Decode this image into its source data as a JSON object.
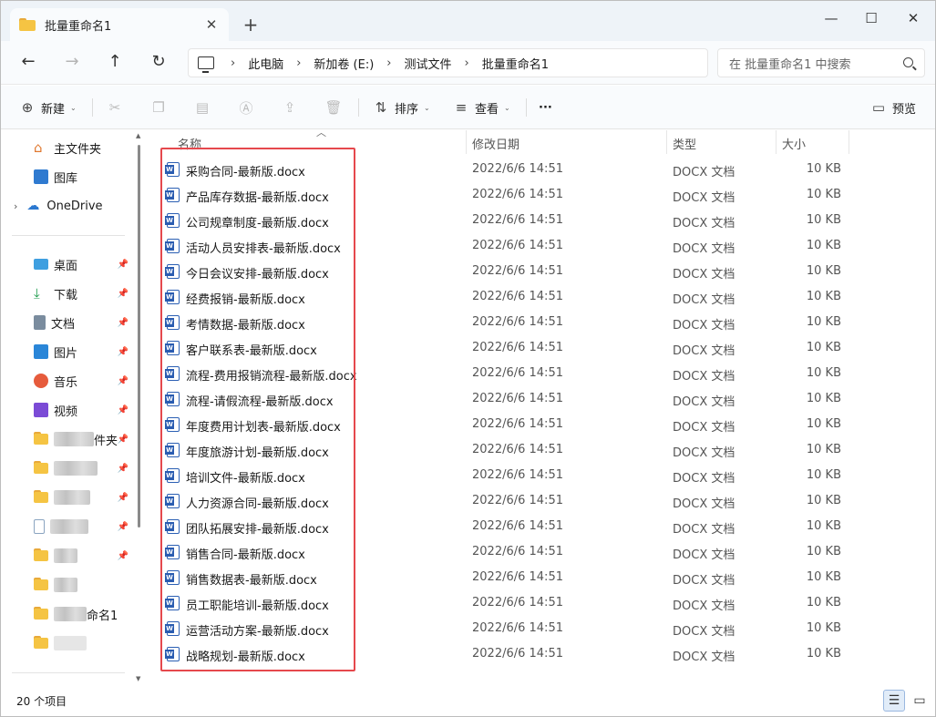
{
  "window": {
    "tab_title": "批量重命名1",
    "tab_close": "✕",
    "new_tab": "+",
    "minimize": "—",
    "maximize": "☐",
    "close": "✕"
  },
  "nav": {
    "back": "←",
    "forward": "→",
    "up": "↑",
    "refresh": "↻",
    "breadcrumb": [
      "此电脑",
      "新加卷 (E:)",
      "测试文件",
      "批量重命名1"
    ],
    "separator": "›",
    "search_placeholder": "在 批量重命名1 中搜索"
  },
  "toolbar": {
    "new_label": "新建",
    "sort_label": "排序",
    "view_label": "查看",
    "more": "···",
    "preview_label": "预览"
  },
  "sidebar": {
    "home": "主文件夹",
    "gallery": "图库",
    "onedrive": "OneDrive",
    "quick": [
      {
        "label": "桌面"
      },
      {
        "label": "下载"
      },
      {
        "label": "文档"
      },
      {
        "label": "图片"
      },
      {
        "label": "音乐"
      },
      {
        "label": "视频"
      }
    ],
    "folder_new_suffix": "件夹",
    "folder_rename_suffix": "命名1"
  },
  "columns": {
    "name": "名称",
    "modified": "修改日期",
    "type": "类型",
    "size": "大小"
  },
  "files": [
    {
      "name": "采购合同-最新版.docx",
      "modified": "2022/6/6 14:51",
      "type": "DOCX 文档",
      "size": "10 KB"
    },
    {
      "name": "产品库存数据-最新版.docx",
      "modified": "2022/6/6 14:51",
      "type": "DOCX 文档",
      "size": "10 KB"
    },
    {
      "name": "公司规章制度-最新版.docx",
      "modified": "2022/6/6 14:51",
      "type": "DOCX 文档",
      "size": "10 KB"
    },
    {
      "name": "活动人员安排表-最新版.docx",
      "modified": "2022/6/6 14:51",
      "type": "DOCX 文档",
      "size": "10 KB"
    },
    {
      "name": "今日会议安排-最新版.docx",
      "modified": "2022/6/6 14:51",
      "type": "DOCX 文档",
      "size": "10 KB"
    },
    {
      "name": "经费报销-最新版.docx",
      "modified": "2022/6/6 14:51",
      "type": "DOCX 文档",
      "size": "10 KB"
    },
    {
      "name": "考情数据-最新版.docx",
      "modified": "2022/6/6 14:51",
      "type": "DOCX 文档",
      "size": "10 KB"
    },
    {
      "name": "客户联系表-最新版.docx",
      "modified": "2022/6/6 14:51",
      "type": "DOCX 文档",
      "size": "10 KB"
    },
    {
      "name": "流程-费用报销流程-最新版.docx",
      "modified": "2022/6/6 14:51",
      "type": "DOCX 文档",
      "size": "10 KB"
    },
    {
      "name": "流程-请假流程-最新版.docx",
      "modified": "2022/6/6 14:51",
      "type": "DOCX 文档",
      "size": "10 KB"
    },
    {
      "name": "年度费用计划表-最新版.docx",
      "modified": "2022/6/6 14:51",
      "type": "DOCX 文档",
      "size": "10 KB"
    },
    {
      "name": "年度旅游计划-最新版.docx",
      "modified": "2022/6/6 14:51",
      "type": "DOCX 文档",
      "size": "10 KB"
    },
    {
      "name": "培训文件-最新版.docx",
      "modified": "2022/6/6 14:51",
      "type": "DOCX 文档",
      "size": "10 KB"
    },
    {
      "name": "人力资源合同-最新版.docx",
      "modified": "2022/6/6 14:51",
      "type": "DOCX 文档",
      "size": "10 KB"
    },
    {
      "name": "团队拓展安排-最新版.docx",
      "modified": "2022/6/6 14:51",
      "type": "DOCX 文档",
      "size": "10 KB"
    },
    {
      "name": "销售合同-最新版.docx",
      "modified": "2022/6/6 14:51",
      "type": "DOCX 文档",
      "size": "10 KB"
    },
    {
      "name": "销售数据表-最新版.docx",
      "modified": "2022/6/6 14:51",
      "type": "DOCX 文档",
      "size": "10 KB"
    },
    {
      "name": "员工职能培训-最新版.docx",
      "modified": "2022/6/6 14:51",
      "type": "DOCX 文档",
      "size": "10 KB"
    },
    {
      "name": "运营活动方案-最新版.docx",
      "modified": "2022/6/6 14:51",
      "type": "DOCX 文档",
      "size": "10 KB"
    },
    {
      "name": "战略规划-最新版.docx",
      "modified": "2022/6/6 14:51",
      "type": "DOCX 文档",
      "size": "10 KB"
    }
  ],
  "status": {
    "item_count": "20 个项目"
  },
  "colors": {
    "highlight_border": "#e5484d",
    "word_icon": "#2a5cb0",
    "folder": "#f5c443"
  }
}
